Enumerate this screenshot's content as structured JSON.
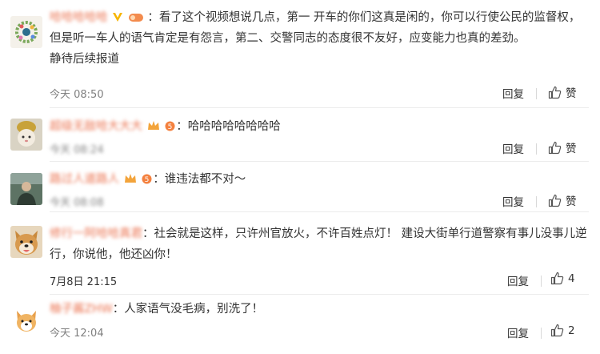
{
  "comments": [
    {
      "username": "哈哈哈哈哈",
      "text": "看了这个视频想说几点，第一 开车的你们这真是闲的，你可以行使公民的监督权，但是听一车人的语气肯定是有怨言，第二、交警同志的态度很不友好，应变能力也真的差劲。",
      "text_line3": "静待后续报道",
      "time": "今天 08:50",
      "reply": "回复",
      "like": "赞"
    },
    {
      "username": "超级无敌哈大大大",
      "text": "哈哈哈哈哈哈哈哈",
      "time": "今天 08:24",
      "reply": "回复",
      "like": "赞"
    },
    {
      "username": "路过人道路人",
      "text": "谁违法都不对～",
      "time": "今天 08:08",
      "reply": "回复",
      "like": "赞"
    },
    {
      "username": "修行一阿哈哈真君",
      "text": "社会就是这样，只许州官放火，不许百姓点灯！ 建设大街单行道警察有事儿没事儿逆行，你说他，他还凶你！",
      "time": "7月8日 21:15",
      "reply": "回复",
      "like": "4"
    },
    {
      "username": "柚子酱ZHW",
      "text": "人家语气没毛病，别洗了！",
      "time": "今天 12:04",
      "reply": "回复",
      "like": "2"
    }
  ],
  "colors": {
    "username": "#eb7350",
    "time": "#808080",
    "text": "#333333"
  }
}
